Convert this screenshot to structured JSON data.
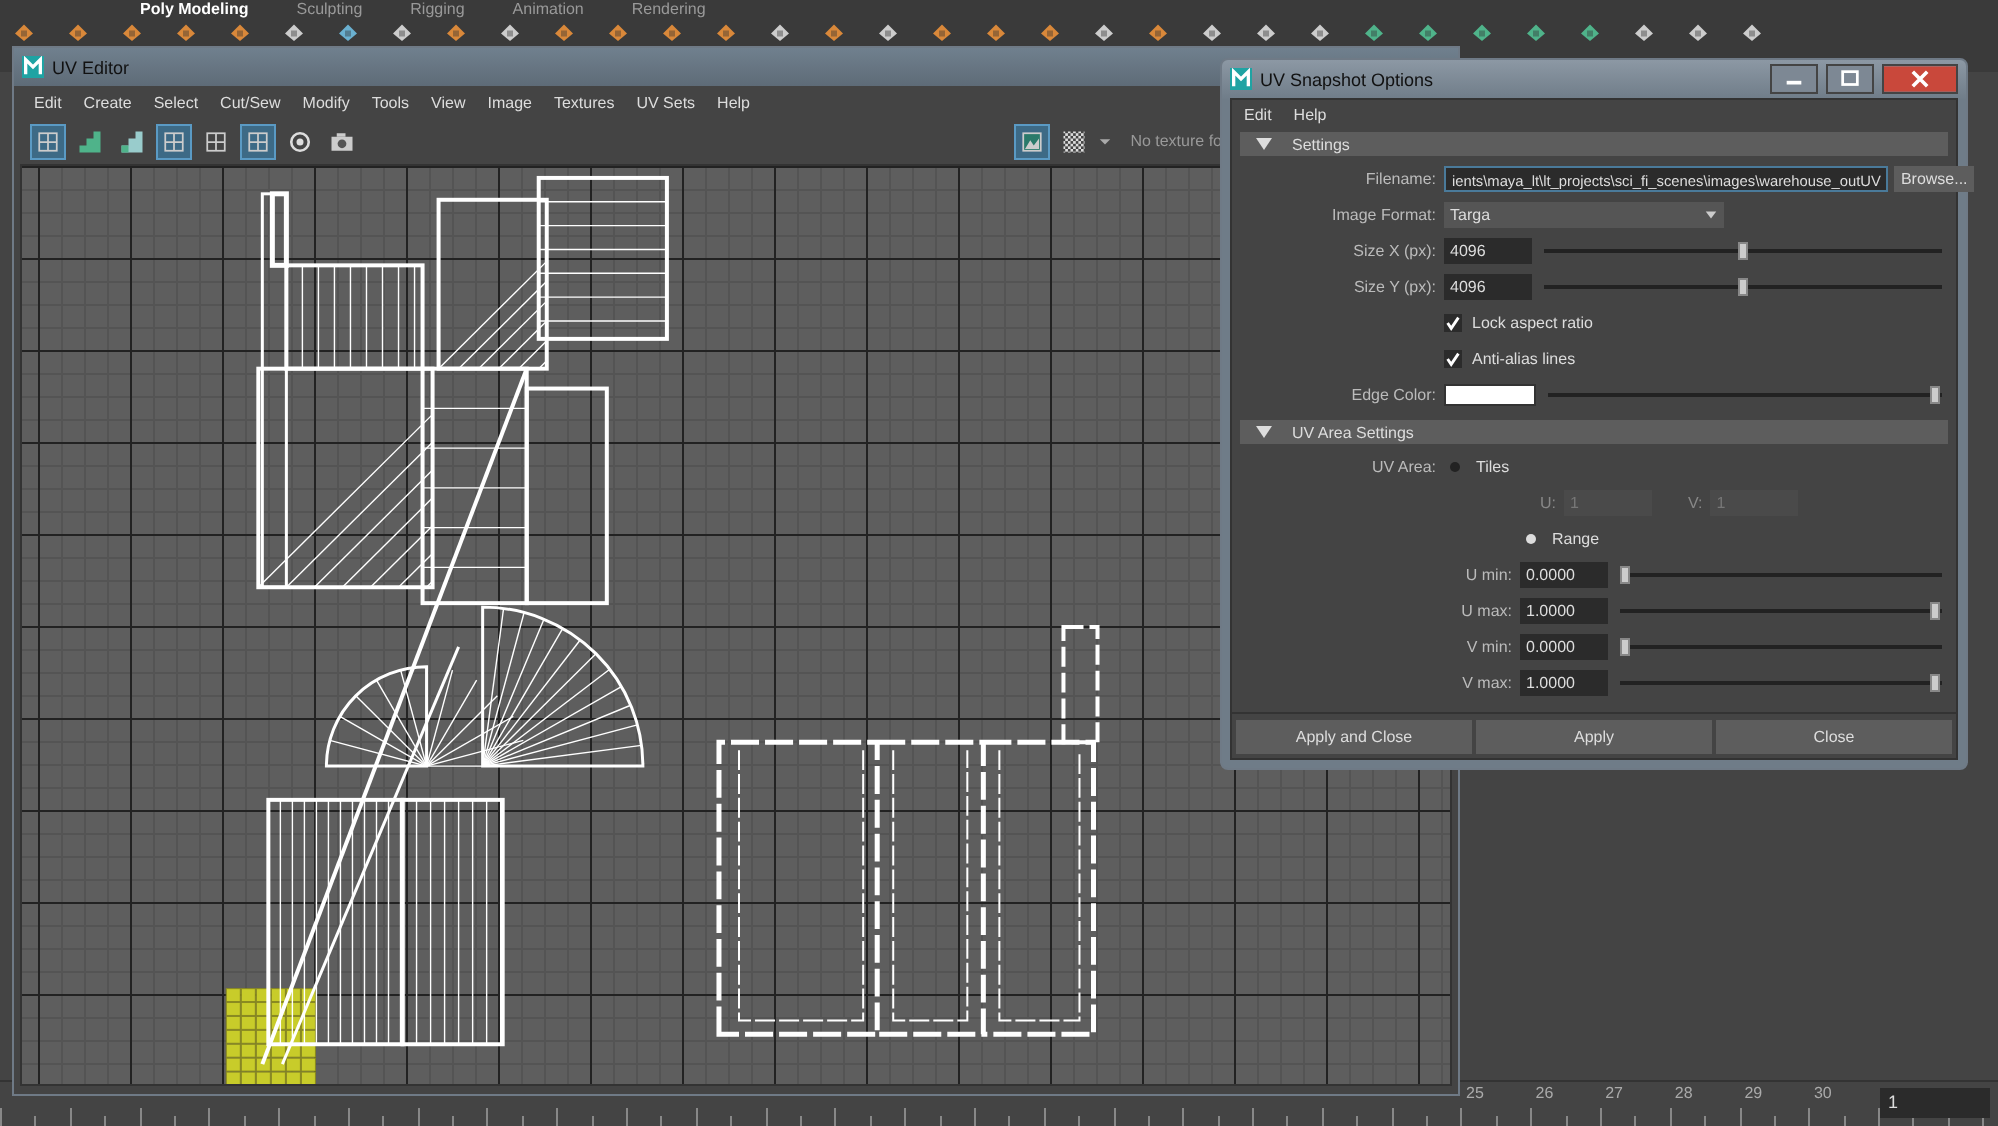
{
  "shelf": {
    "tabs": [
      {
        "label": "Poly Modeling",
        "selected": true
      },
      {
        "label": "Sculpting",
        "selected": false
      },
      {
        "label": "Rigging",
        "selected": false
      },
      {
        "label": "Animation",
        "selected": false
      },
      {
        "label": "Rendering",
        "selected": false
      }
    ]
  },
  "uv_editor": {
    "title": "UV Editor",
    "menu": [
      "Edit",
      "Create",
      "Select",
      "Cut/Sew",
      "Modify",
      "Tools",
      "View",
      "Image",
      "Textures",
      "UV Sets",
      "Help"
    ],
    "tools": [
      {
        "kind": "grid-select",
        "selected": true
      },
      {
        "kind": "stairs",
        "selected": false
      },
      {
        "kind": "stairs-shaded",
        "selected": false
      },
      {
        "kind": "frame",
        "selected": true
      },
      {
        "kind": "grid-small",
        "selected": false
      },
      {
        "kind": "dots",
        "selected": true
      },
      {
        "kind": "target",
        "selected": false
      },
      {
        "kind": "camera",
        "selected": false
      }
    ],
    "image_toggle_selected": true,
    "texture_label": "No texture fo"
  },
  "snapshot": {
    "title": "UV Snapshot Options",
    "menu": [
      "Edit",
      "Help"
    ],
    "sections": [
      {
        "title": "Settings",
        "expanded": true,
        "rows": [
          {
            "kind": "file",
            "label": "Filename:",
            "value": "ients\\maya_lt\\lt_projects\\sci_fi_scenes\\images\\warehouse_outUV",
            "button": "Browse..."
          },
          {
            "kind": "dropdown",
            "label": "Image Format:",
            "value": "Targa"
          },
          {
            "kind": "slider",
            "label": "Size X (px):",
            "value": "4096",
            "level": 0.5
          },
          {
            "kind": "slider",
            "label": "Size Y (px):",
            "value": "4096",
            "level": 0.5
          },
          {
            "kind": "checkbox",
            "text": "Lock aspect ratio",
            "checked": true
          },
          {
            "kind": "checkbox",
            "text": "Anti-alias lines",
            "checked": true
          },
          {
            "kind": "color",
            "label": "Edge Color:",
            "color": "#ffffff",
            "level": 1
          }
        ]
      },
      {
        "title": "UV Area Settings",
        "expanded": true,
        "rows": [
          {
            "kind": "radio",
            "label": "UV Area:",
            "text": "Tiles",
            "selected": false
          },
          {
            "kind": "pair",
            "disabled": true,
            "u_label": "U:",
            "u_value": "1",
            "v_label": "V:",
            "v_value": "1"
          },
          {
            "kind": "radio",
            "text": "Range",
            "selected": true
          },
          {
            "kind": "slider",
            "label": "U min:",
            "value": "0.0000",
            "level": 0
          },
          {
            "kind": "slider",
            "label": "U max:",
            "value": "1.0000",
            "level": 1
          },
          {
            "kind": "slider",
            "label": "V min:",
            "value": "0.0000",
            "level": 0
          },
          {
            "kind": "slider",
            "label": "V max:",
            "value": "1.0000",
            "level": 1
          }
        ]
      }
    ],
    "buttons": [
      "Apply and Close",
      "Apply",
      "Close"
    ]
  },
  "timeline": {
    "frames": [
      "25",
      "26",
      "27",
      "28",
      "29",
      "30"
    ],
    "current_frame": "1"
  }
}
